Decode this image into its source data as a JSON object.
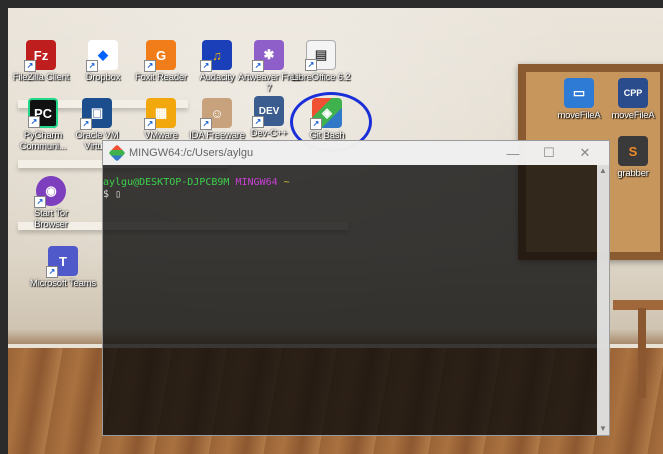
{
  "desktop": {
    "icons": [
      {
        "label": "FileZilla Client",
        "icon": "filezilla-icon",
        "color": "#bf1e1e",
        "glyph": "Fz"
      },
      {
        "label": "Dropbox",
        "icon": "dropbox-icon",
        "color": "#0061fe",
        "glyph": "◆"
      },
      {
        "label": "Foxit Reader",
        "icon": "foxit-reader-icon",
        "color": "#f07d1a",
        "glyph": "G"
      },
      {
        "label": "Audacity",
        "icon": "audacity-icon",
        "color": "#1a3fb8",
        "glyph": "♫"
      },
      {
        "label": "Artweaver Free 7",
        "icon": "artweaver-icon",
        "color": "#8e5fc9",
        "glyph": "✱"
      },
      {
        "label": "LibreOffice 6.2",
        "icon": "libreoffice-icon",
        "color": "#f4f4f4",
        "glyph": "▤"
      },
      {
        "label": "PyCharm Communi...",
        "icon": "pycharm-icon",
        "color": "#111111",
        "glyph": "PC"
      },
      {
        "label": "Oracle VM Virtu...",
        "icon": "virtualbox-icon",
        "color": "#1c4d8c",
        "glyph": "▣"
      },
      {
        "label": "VMware",
        "icon": "vmware-icon",
        "color": "#f2a80d",
        "glyph": "▦"
      },
      {
        "label": "IDA Freeware",
        "icon": "ida-icon",
        "color": "#c8a27c",
        "glyph": "☺"
      },
      {
        "label": "Dev-C++",
        "icon": "dev-cpp-icon",
        "color": "#3a5c8f",
        "glyph": "DEV"
      },
      {
        "label": "Git Bash",
        "icon": "git-bash-icon",
        "color": "#f05133",
        "glyph": "◈"
      },
      {
        "label": "Start Tor Browser",
        "icon": "tor-browser-icon",
        "color": "#7d3fbe",
        "glyph": "◉"
      },
      {
        "label": "Microsoft Teams",
        "icon": "teams-icon",
        "color": "#5059c9",
        "glyph": "T"
      },
      {
        "label": "moveFileA",
        "icon": "file-icon",
        "color": "#2e7bd6",
        "glyph": "▭"
      },
      {
        "label": "moveFileA",
        "icon": "cpp-file-icon",
        "color": "#2a4c8c",
        "glyph": "CPP"
      },
      {
        "label": "grabber",
        "icon": "sublime-icon",
        "color": "#f08a24",
        "glyph": "S"
      }
    ]
  },
  "terminal": {
    "title": "MINGW64:/c/Users/aylgu",
    "prompt_user": "aylgu@DESKTOP-DJPCB9M",
    "prompt_env": "MINGW64",
    "prompt_path": "~",
    "prompt_symbol": "$",
    "controls": {
      "minimize": "—",
      "maximize": "☐",
      "close": "✕"
    }
  },
  "colors": {
    "highlight_circle": "#1a2fd8",
    "prompt_green": "#3bd14b",
    "prompt_purple": "#c93fd6",
    "prompt_yellow": "#d8c23a"
  }
}
